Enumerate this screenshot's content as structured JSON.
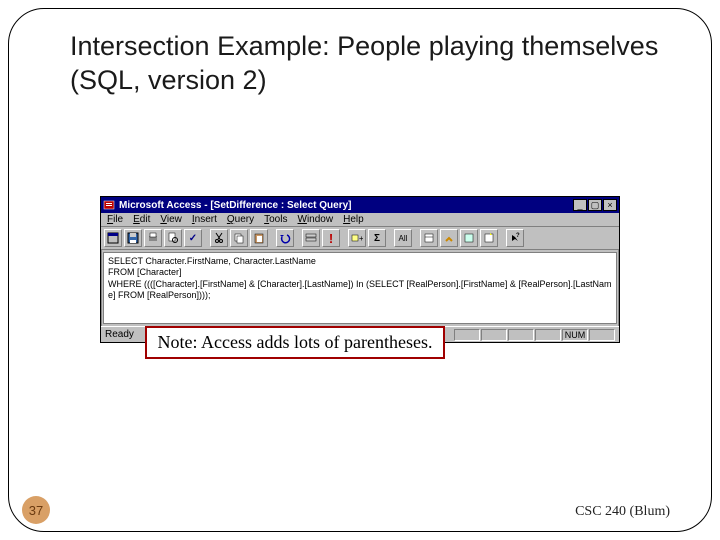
{
  "slide": {
    "title": "Intersection Example: People playing themselves (SQL, version 2)",
    "number": "37",
    "footer": "CSC 240 (Blum)"
  },
  "access": {
    "titlebar": "Microsoft Access - [SetDifference : Select Query]",
    "menus": {
      "file": "File",
      "edit": "Edit",
      "view": "View",
      "insert": "Insert",
      "query": "Query",
      "tools": "Tools",
      "window": "Window",
      "help": "Help"
    },
    "sql": "SELECT Character.FirstName, Character.LastName\nFROM [Character]\nWHERE ((([Character].[FirstName] & [Character].[LastName]) In (SELECT [RealPerson].[FirstName] & [RealPerson].[LastName] FROM [RealPerson])));",
    "status": "Ready",
    "indicator": "NUM"
  },
  "note": "Note: Access adds lots of parentheses."
}
